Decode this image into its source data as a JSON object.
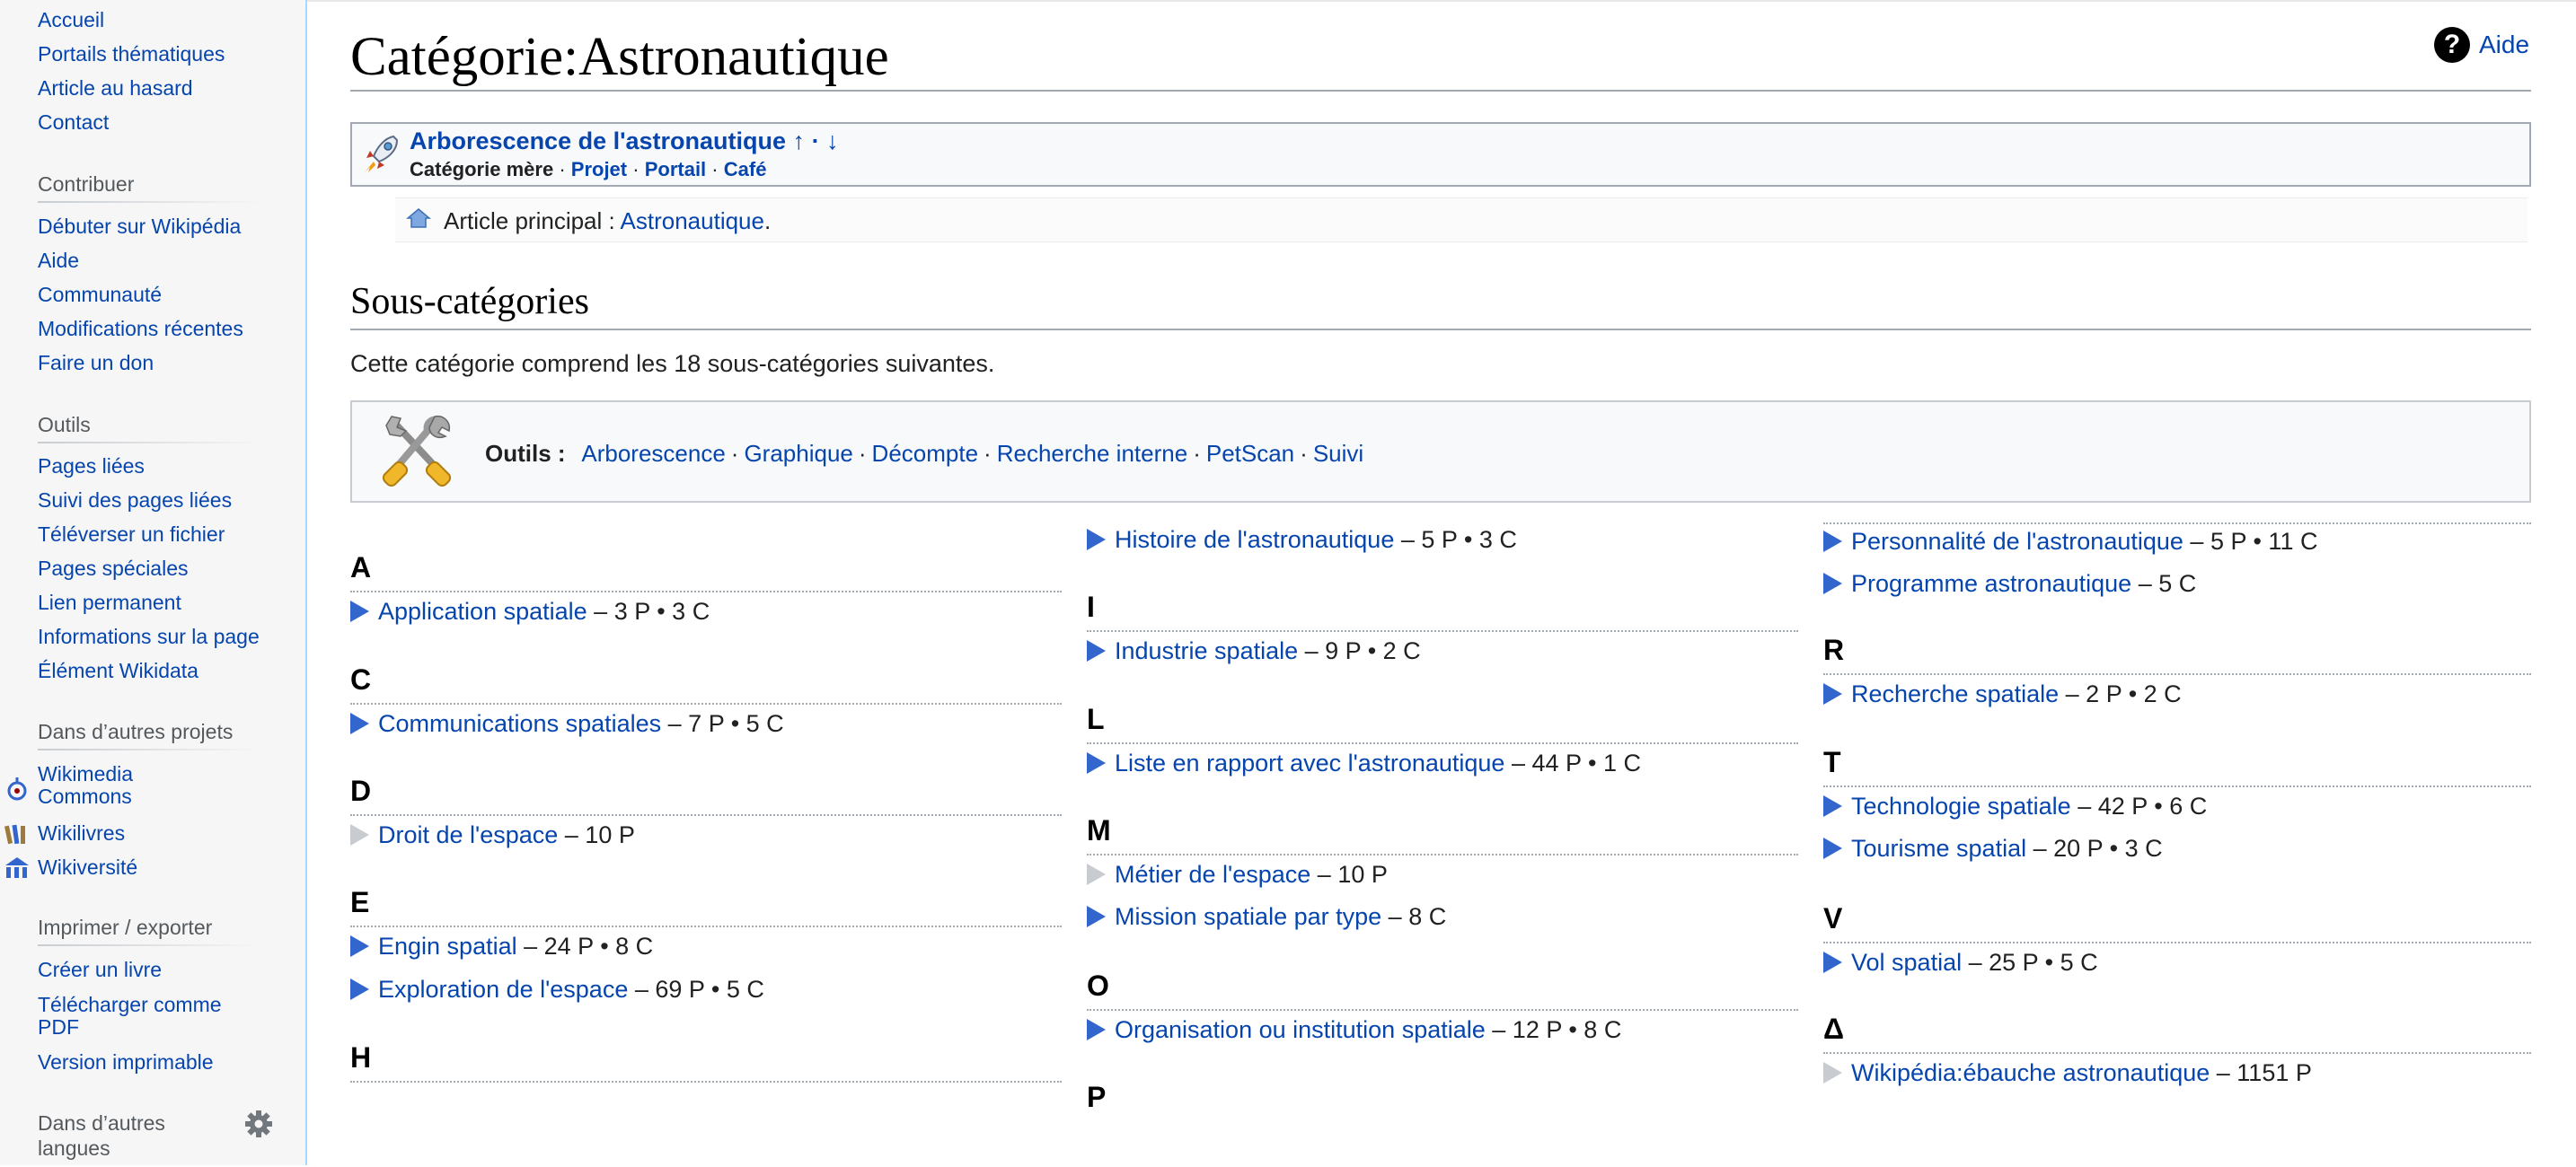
{
  "sidebar": {
    "nav": [
      "Accueil",
      "Portails thématiques",
      "Article au hasard",
      "Contact"
    ],
    "contribute": {
      "heading": "Contribuer",
      "items": [
        "Débuter sur Wikipédia",
        "Aide",
        "Communauté",
        "Modifications récentes",
        "Faire un don"
      ]
    },
    "tools": {
      "heading": "Outils",
      "items": [
        "Pages liées",
        "Suivi des pages liées",
        "Téléverser un fichier",
        "Pages spéciales",
        "Lien permanent",
        "Informations sur la page",
        "Élément Wikidata"
      ]
    },
    "projects": {
      "heading": "Dans d’autres projets",
      "items": [
        "Wikimedia",
        "Commons",
        "Wikilivres",
        "Wikiversité"
      ]
    },
    "print": {
      "heading": "Imprimer / exporter",
      "items": [
        "Créer un livre",
        "Télécharger comme",
        "PDF",
        "Version imprimable"
      ]
    },
    "languages": {
      "heading_line1": "Dans d’autres",
      "heading_line2": "langues"
    }
  },
  "page": {
    "title": "Catégorie:Astronautique",
    "help": "Aide",
    "tree": {
      "title": "Arborescence de l'astronautique",
      "up_arrow": "↑",
      "dot": "·",
      "down_arrow": "↓",
      "parent": "Catégorie mère",
      "links": [
        "Projet",
        "Portail",
        "Café"
      ],
      "sep": "·"
    },
    "main_article": {
      "label": "Article principal :",
      "link": "Astronautique",
      "end": "."
    },
    "section": {
      "title": "Sous-catégories",
      "intro": "Cette catégorie comprend les 18 sous-catégories suivantes."
    },
    "tools_box": {
      "label": "Outils :",
      "links": [
        "Arborescence",
        "Graphique",
        "Décompte",
        "Recherche interne",
        "PetScan",
        "Suivi"
      ],
      "sep": "·"
    }
  },
  "columns": {
    "col1": {
      "A": {
        "letter": "A",
        "entries": [
          {
            "name": "Application spatiale",
            "count": "– 3 P • 3 C"
          }
        ]
      },
      "C": {
        "letter": "C",
        "entries": [
          {
            "name": "Communications spatiales",
            "count": "– 7 P • 5 C"
          }
        ]
      },
      "D": {
        "letter": "D",
        "entries": [
          {
            "name": "Droit de l'espace",
            "count": "– 10 P"
          }
        ]
      },
      "E": {
        "letter": "E",
        "entries": [
          {
            "name": "Engin spatial",
            "count": "– 24 P • 8 C"
          },
          {
            "name": "Exploration de l'espace",
            "count": "– 69 P • 5 C"
          }
        ]
      },
      "H": {
        "letter": "H"
      }
    },
    "col2": {
      "H_cont": {
        "entries": [
          {
            "name": "Histoire de l'astronautique",
            "count": "– 5 P • 3 C"
          }
        ]
      },
      "I": {
        "letter": "I",
        "entries": [
          {
            "name": "Industrie spatiale",
            "count": "– 9 P • 2 C"
          }
        ]
      },
      "L": {
        "letter": "L",
        "entries": [
          {
            "name": "Liste en rapport avec l'astronautique",
            "count": "– 44 P • 1 C"
          }
        ]
      },
      "M": {
        "letter": "M",
        "entries": [
          {
            "name": "Métier de l'espace",
            "count": "– 10 P"
          },
          {
            "name": "Mission spatiale par type",
            "count": "– 8 C"
          }
        ]
      },
      "O": {
        "letter": "O",
        "entries": [
          {
            "name": "Organisation ou institution spatiale",
            "count": "– 12 P • 8 C"
          }
        ]
      },
      "P": {
        "letter": "P"
      }
    },
    "col3": {
      "P_cont": {
        "entries": [
          {
            "name": "Personnalité de l'astronautique",
            "count": "– 5 P • 11 C"
          },
          {
            "name": "Programme astronautique",
            "count": "– 5 C"
          }
        ]
      },
      "R": {
        "letter": "R",
        "entries": [
          {
            "name": "Recherche spatiale",
            "count": "– 2 P • 2 C"
          }
        ]
      },
      "T": {
        "letter": "T",
        "entries": [
          {
            "name": "Technologie spatiale",
            "count": "– 42 P • 6 C"
          },
          {
            "name": "Tourisme spatial",
            "count": "– 20 P • 3 C"
          }
        ]
      },
      "V": {
        "letter": "V",
        "entries": [
          {
            "name": "Vol spatial",
            "count": "– 25 P • 5 C"
          }
        ]
      },
      "Delta": {
        "letter": "Δ",
        "entries": [
          {
            "name": "Wikipédia:ébauche astronautique",
            "count": "– 1151 P"
          }
        ]
      }
    }
  },
  "colors": {
    "link": "#0645ad",
    "triangle": "#3366cc",
    "triangle_empty": "#c8ccd1",
    "rule": "#a2a9b1"
  }
}
